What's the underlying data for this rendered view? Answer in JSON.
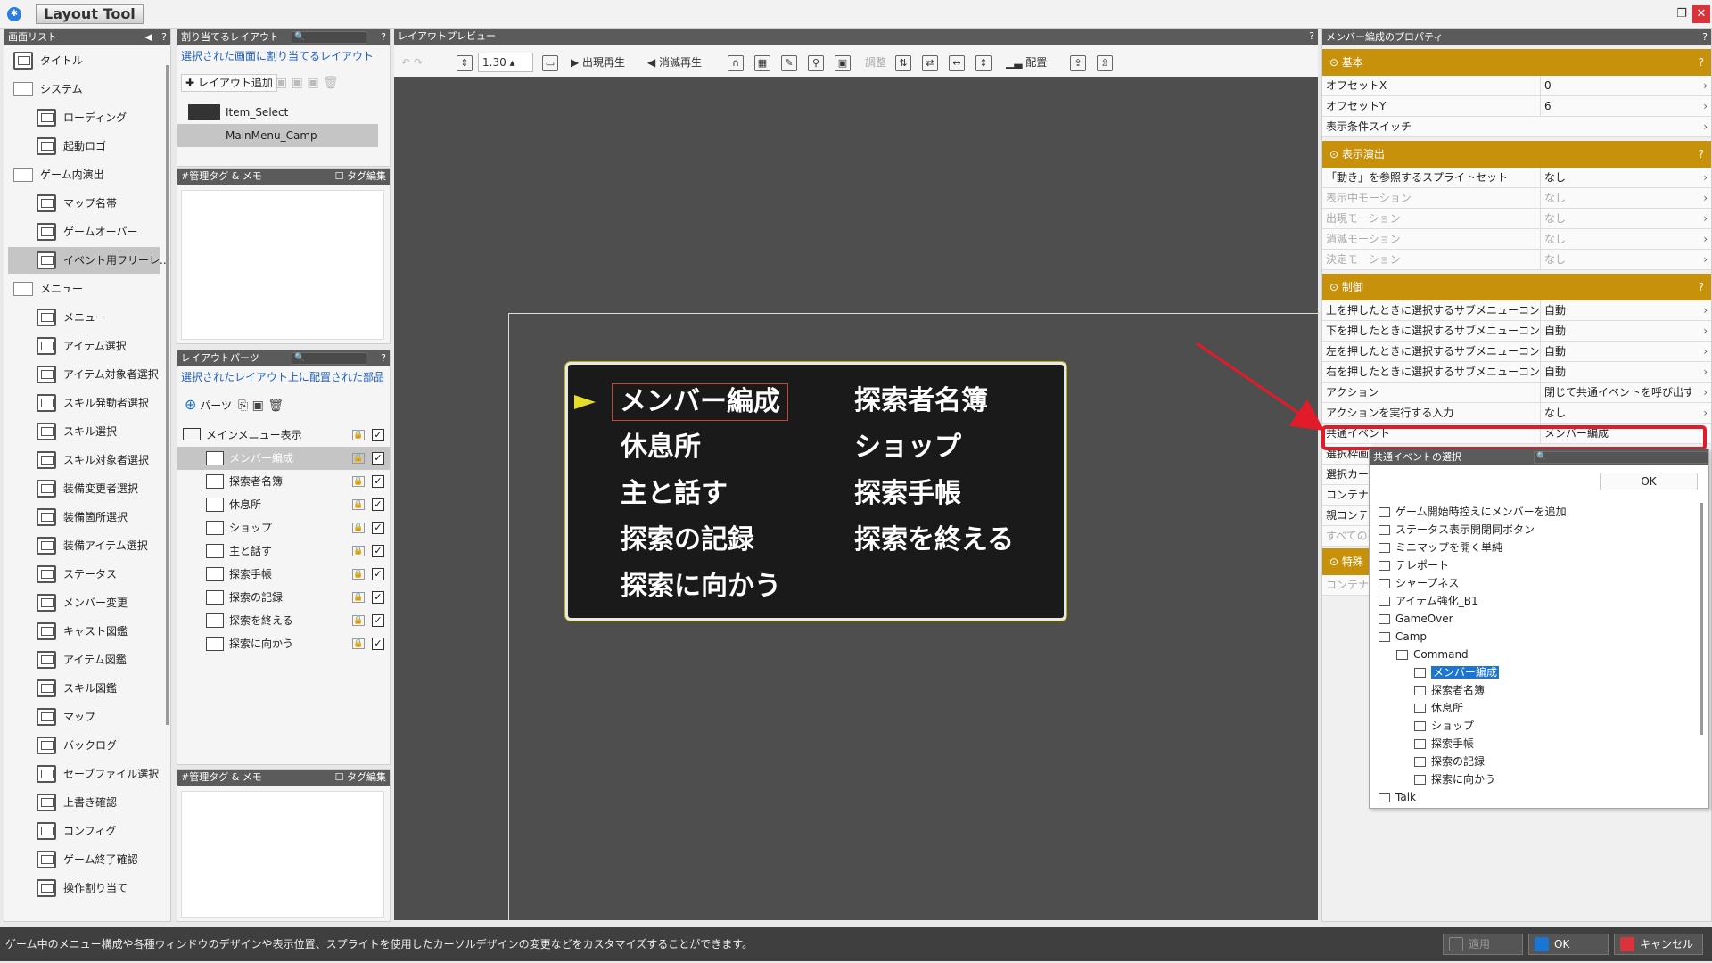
{
  "app": {
    "title": "Layout Tool"
  },
  "screen_list": {
    "header": "画面リスト",
    "help": "?",
    "items": [
      {
        "label": "タイトル",
        "type": "screen",
        "indent": 0
      },
      {
        "label": "システム",
        "type": "folder",
        "indent": 0
      },
      {
        "label": "ローディング",
        "type": "screen",
        "indent": 1
      },
      {
        "label": "起動ロゴ",
        "type": "screen",
        "indent": 1
      },
      {
        "label": "ゲーム内演出",
        "type": "folder",
        "indent": 0
      },
      {
        "label": "マップ名帯",
        "type": "screen",
        "indent": 1
      },
      {
        "label": "ゲームオーバー",
        "type": "screen",
        "indent": 1
      },
      {
        "label": "イベント用フリーレ...",
        "type": "screen",
        "indent": 1,
        "selected": true
      },
      {
        "label": "メニュー",
        "type": "folder",
        "indent": 0
      },
      {
        "label": "メニュー",
        "type": "screen",
        "indent": 1
      },
      {
        "label": "アイテム選択",
        "type": "screen",
        "indent": 1
      },
      {
        "label": "アイテム対象者選択",
        "type": "screen",
        "indent": 1
      },
      {
        "label": "スキル発動者選択",
        "type": "screen",
        "indent": 1
      },
      {
        "label": "スキル選択",
        "type": "screen",
        "indent": 1
      },
      {
        "label": "スキル対象者選択",
        "type": "screen",
        "indent": 1
      },
      {
        "label": "装備変更者選択",
        "type": "screen",
        "indent": 1
      },
      {
        "label": "装備箇所選択",
        "type": "screen",
        "indent": 1
      },
      {
        "label": "装備アイテム選択",
        "type": "screen",
        "indent": 1
      },
      {
        "label": "ステータス",
        "type": "screen",
        "indent": 1
      },
      {
        "label": "メンバー変更",
        "type": "screen",
        "indent": 1
      },
      {
        "label": "キャスト図鑑",
        "type": "screen",
        "indent": 1
      },
      {
        "label": "アイテム図鑑",
        "type": "screen",
        "indent": 1
      },
      {
        "label": "スキル図鑑",
        "type": "screen",
        "indent": 1
      },
      {
        "label": "マップ",
        "type": "screen",
        "indent": 1
      },
      {
        "label": "バックログ",
        "type": "screen",
        "indent": 1
      },
      {
        "label": "セーブファイル選択",
        "type": "screen",
        "indent": 1
      },
      {
        "label": "上書き確認",
        "type": "screen",
        "indent": 1
      },
      {
        "label": "コンフィグ",
        "type": "screen",
        "indent": 1
      },
      {
        "label": "ゲーム終了確認",
        "type": "screen",
        "indent": 1
      },
      {
        "label": "操作割り当て",
        "type": "screen",
        "indent": 1
      }
    ]
  },
  "assigned_layout": {
    "header": "割り当てるレイアウト",
    "help": "?",
    "subtitle": "選択された画面に割り当てるレイアウト",
    "add_label": "レイアウト追加",
    "items": [
      {
        "label": "Item_Select"
      },
      {
        "label": "MainMenu_Camp",
        "selected": true
      }
    ]
  },
  "tag_memo_1": {
    "header": "#管理タグ & メモ",
    "tag_edit": "タグ編集"
  },
  "layout_parts": {
    "header": "レイアウトパーツ",
    "help": "?",
    "subtitle": "選択されたレイアウト上に配置された部品",
    "parts_label": "パーツ",
    "root": "メインメニュー表示",
    "items": [
      "メンバー編成",
      "探索者名簿",
      "休息所",
      "ショップ",
      "主と話す",
      "探索手帳",
      "探索の記録",
      "探索を終える",
      "探索に向かう"
    ]
  },
  "tag_memo_2": {
    "header": "#管理タグ & メモ",
    "tag_edit": "タグ編集"
  },
  "preview": {
    "header": "レイアウトプレビュー",
    "help": "?",
    "zoom": "1.30",
    "play_appear": "出現再生",
    "play_disappear": "消滅再生",
    "adjust": "調整",
    "place": "配置",
    "menu_left": [
      "メンバー編成",
      "休息所",
      "主と話す",
      "探索の記録",
      "探索に向かう"
    ],
    "menu_right": [
      "探索者名簿",
      "ショップ",
      "探索手帳",
      "探索を終える"
    ]
  },
  "props": {
    "header": "メンバー編成のプロパティ",
    "sec_basic": "基本",
    "sec_effect": "表示演出",
    "sec_control": "制御",
    "sec_special": "特殊",
    "help": "?",
    "basic": [
      {
        "k": "オフセットX",
        "v": "0"
      },
      {
        "k": "オフセットY",
        "v": "6"
      },
      {
        "k": "表示条件スイッチ",
        "v": ""
      }
    ],
    "effect": [
      {
        "k": "「動き」を参照するスプライトセット",
        "v": "なし",
        "dim": false
      },
      {
        "k": "表示中モーション",
        "v": "なし",
        "dim": true
      },
      {
        "k": "出現モーション",
        "v": "なし",
        "dim": true
      },
      {
        "k": "消滅モーション",
        "v": "なし",
        "dim": true
      },
      {
        "k": "決定モーション",
        "v": "なし",
        "dim": true
      }
    ],
    "control": [
      {
        "k": "上を押したときに選択するサブメニューコンテナ",
        "v": "自動"
      },
      {
        "k": "下を押したときに選択するサブメニューコンテナ",
        "v": "自動"
      },
      {
        "k": "左を押したときに選択するサブメニューコンテナ",
        "v": "自動"
      },
      {
        "k": "右を押したときに選択するサブメニューコンテナ",
        "v": "自動"
      },
      {
        "k": "アクション",
        "v": "閉じて共通イベントを呼び出す"
      },
      {
        "k": "アクションを実行する入力",
        "v": "なし"
      },
      {
        "k": "共通イベント",
        "v": "メンバー編成"
      }
    ],
    "hidden_rows": [
      "選択枠画",
      "選択カー",
      "コンテナ管",
      "親コンテナ",
      "すべての要"
    ],
    "special_row": "コンテナ管"
  },
  "popup": {
    "title": "共通イベントの選択",
    "ok": "OK",
    "items": [
      {
        "label": "ゲーム開始時控えにメンバーを追加",
        "lvl": 0,
        "type": "ev"
      },
      {
        "label": "ステータス表示開閉同ボタン",
        "lvl": 0,
        "type": "ev"
      },
      {
        "label": "ミニマップを開く単純",
        "lvl": 0,
        "type": "ev"
      },
      {
        "label": "テレポート",
        "lvl": 0,
        "type": "ev"
      },
      {
        "label": "シャープネス",
        "lvl": 0,
        "type": "ev"
      },
      {
        "label": "アイテム強化_B1",
        "lvl": 0,
        "type": "ev"
      },
      {
        "label": "GameOver",
        "lvl": 0,
        "type": "ev"
      },
      {
        "label": "Camp",
        "lvl": 0,
        "type": "folder"
      },
      {
        "label": "Command",
        "lvl": 1,
        "type": "folder"
      },
      {
        "label": "メンバー編成",
        "lvl": 2,
        "type": "ev",
        "selected": true
      },
      {
        "label": "探索者名簿",
        "lvl": 2,
        "type": "ev"
      },
      {
        "label": "休息所",
        "lvl": 2,
        "type": "ev"
      },
      {
        "label": "ショップ",
        "lvl": 2,
        "type": "ev"
      },
      {
        "label": "探索手帳",
        "lvl": 2,
        "type": "ev"
      },
      {
        "label": "探索の記録",
        "lvl": 2,
        "type": "ev"
      },
      {
        "label": "探索に向かう",
        "lvl": 2,
        "type": "ev"
      },
      {
        "label": "Talk",
        "lvl": 0,
        "type": "folder"
      }
    ]
  },
  "status": {
    "text": "ゲーム中のメニュー構成や各種ウィンドウのデザインや表示位置、スプライトを使用したカーソルデザインの変更などをカスタマイズすることができます。",
    "apply": "適用",
    "ok": "OK",
    "cancel": "キャンセル"
  },
  "colors": {
    "section": "#c8910c",
    "highlight": "#e21b2b",
    "selection": "#1a76d2",
    "cursor": "#e6dd2a"
  }
}
